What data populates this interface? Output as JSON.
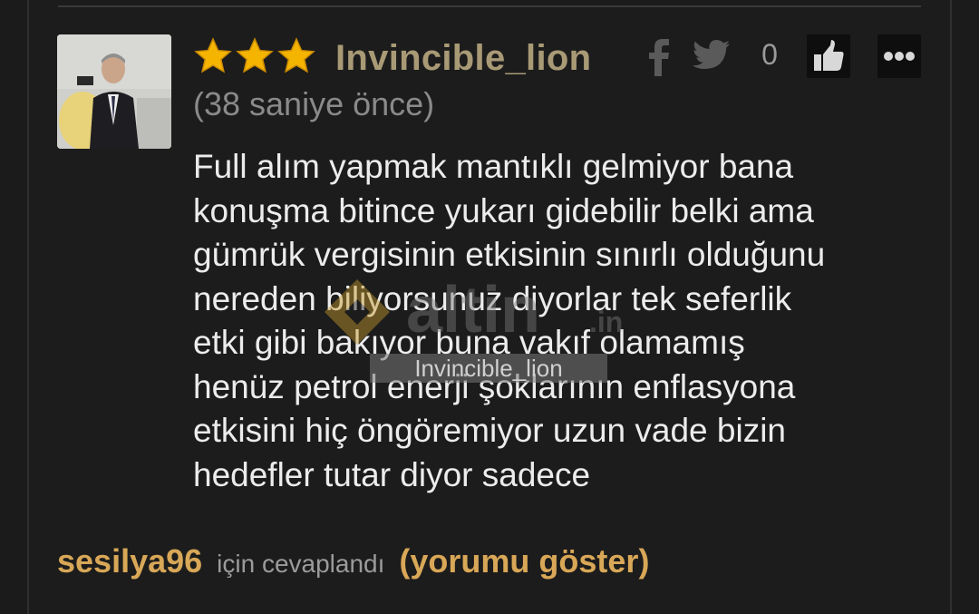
{
  "comment": {
    "author": "Invincible_lion",
    "rank_stars": 3,
    "timestamp": "(38 saniye önce)",
    "like_count": "0",
    "lines": [
      "Full alım yapmak mantıklı gelmiyor bana",
      "konuşma bitince yukarı gidebilir belki ama",
      "gümrük vergisinin etkisinin sınırlı olduğunu",
      "nereden biliyorsunuz diyorlar tek seferlik",
      "etki gibi bakıyor buna vakıf olamamış",
      "henüz petrol enerji şoklarının enflasyona",
      "etkisini hiç öngöremiyor uzun vade bizin",
      "hedefler tutar diyor sadece"
    ],
    "watermark_brand": "altin.in",
    "watermark_user": "Invincible_lion"
  },
  "reply": {
    "to_user": "sesilya96",
    "label": "için cevaplandı",
    "show_link": "(yorumu göster)"
  },
  "icons": {
    "share_facebook": "facebook-icon",
    "share_twitter": "twitter-icon",
    "like": "thumbs-up-icon",
    "more": "more-icon",
    "rank": "star-icon"
  },
  "colors": {
    "background": "#1c1c1c",
    "username": "#a99a76",
    "star": "#f5b400",
    "reply_accent": "#d8a757",
    "text": "#ececec",
    "muted": "#8a8a8a"
  }
}
